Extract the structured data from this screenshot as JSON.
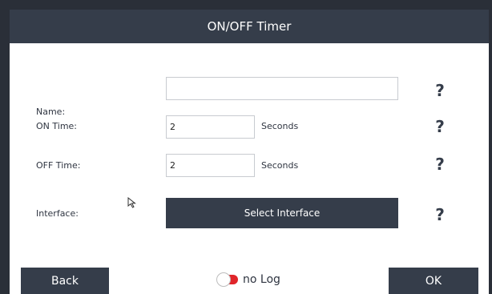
{
  "window": {
    "title": "ON/OFF Timer"
  },
  "form": {
    "name": {
      "label": "Name:",
      "value": ""
    },
    "on_time": {
      "label": "ON Time:",
      "value": "2",
      "unit": "Seconds"
    },
    "off_time": {
      "label": "OFF Time:",
      "value": "2",
      "unit": "Seconds"
    },
    "interface": {
      "label": "Interface:",
      "button_label": "Select Interface"
    },
    "help_symbol": "?"
  },
  "footer": {
    "back_label": "Back",
    "ok_label": "OK",
    "log_toggle": {
      "label": "no Log",
      "state": "off",
      "color": "#e0252a"
    }
  },
  "colors": {
    "header_bg": "#353d4a",
    "button_bg": "#353d4a",
    "text": "#2f3541"
  },
  "icons": {
    "cursor": "mouse-pointer-icon",
    "help": "question-mark-icon",
    "toggle": "toggle-switch-icon"
  }
}
